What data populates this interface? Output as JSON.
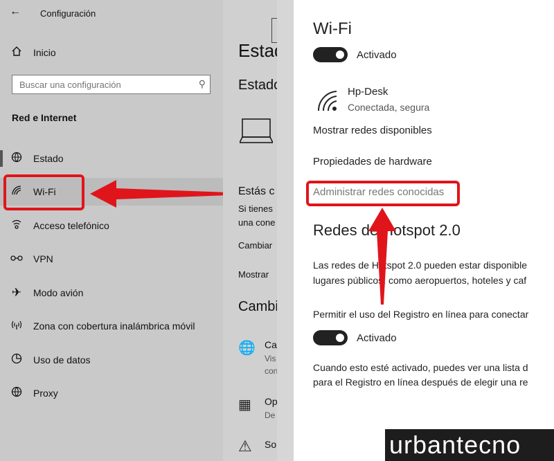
{
  "sidebar": {
    "back_icon": "back-arrow-icon",
    "title": "Configuración",
    "home_label": "Inicio",
    "search_placeholder": "Buscar una configuración",
    "section_title": "Red e Internet",
    "items": [
      {
        "label": "Estado",
        "icon": "globe-icon"
      },
      {
        "label": "Wi-Fi",
        "icon": "wifi-icon"
      },
      {
        "label": "Acceso telefónico",
        "icon": "dialup-icon"
      },
      {
        "label": "VPN",
        "icon": "vpn-icon"
      },
      {
        "label": "Modo avión",
        "icon": "airplane-icon"
      },
      {
        "label": "Zona con cobertura inalámbrica móvil",
        "icon": "hotspot-icon"
      },
      {
        "label": "Uso de datos",
        "icon": "data-usage-icon"
      },
      {
        "label": "Proxy",
        "icon": "globe-icon"
      }
    ]
  },
  "middle": {
    "heading": "Estad",
    "subheading": "Estado",
    "connected_title": "Estás c",
    "connected_text_1": "Si tienes",
    "connected_text_2": "una cone",
    "link_change": "Cambiar",
    "link_show": "Mostrar",
    "section_change": "Cambi",
    "item_1_title": "Ca",
    "item_1_sub_1": "Vis",
    "item_1_sub_2": "con",
    "item_2_title": "Op",
    "item_2_sub": "De",
    "item_3_title": "So"
  },
  "wifi_panel": {
    "title": "Wi-Fi",
    "toggle_label": "Activado",
    "toggle_on": true,
    "network_name": "Hp-Desk",
    "network_status": "Conectada, segura",
    "link_show_networks": "Mostrar redes disponibles",
    "link_hardware": "Propiedades de hardware",
    "link_manage": "Administrar redes conocidas",
    "hotspot_title": "Redes de Hotspot 2.0",
    "hotspot_desc_1": "Las redes de Hotspot 2.0 pueden estar disponible",
    "hotspot_desc_2": "lugares públicos, como aeropuertos, hoteles y caf",
    "registry_label": "Permitir el uso del Registro en línea para conectar",
    "registry_toggle_label": "Activado",
    "registry_toggle_on": true,
    "registry_desc_1": "Cuando esto esté activado, puedes ver una lista d",
    "registry_desc_2": "para el Registro en línea después de elegir una re"
  },
  "watermark": "urbantecno",
  "colors": {
    "annotation_red": "#e0151b",
    "toggle_on": "#222222"
  }
}
